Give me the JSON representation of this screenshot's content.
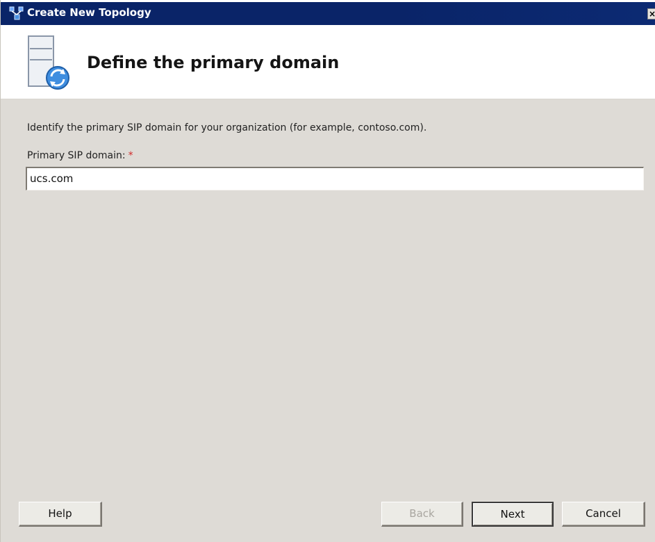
{
  "window": {
    "title": "Create New Topology",
    "close_glyph": "×",
    "colors": {
      "titlebar": "#0a2468",
      "header_bg": "#ffffff",
      "content_bg": "#dedbd6",
      "required": "#d12a2a"
    }
  },
  "header": {
    "title": "Define the primary domain",
    "icon": "server-sync-icon"
  },
  "form": {
    "instruction": "Identify the primary SIP domain for your organization (for example, contoso.com).",
    "field_label": "Primary SIP domain:",
    "required_mark": "*",
    "field_value": "ucs.com"
  },
  "buttons": {
    "help": "Help",
    "back": "Back",
    "next": "Next",
    "cancel": "Cancel"
  }
}
